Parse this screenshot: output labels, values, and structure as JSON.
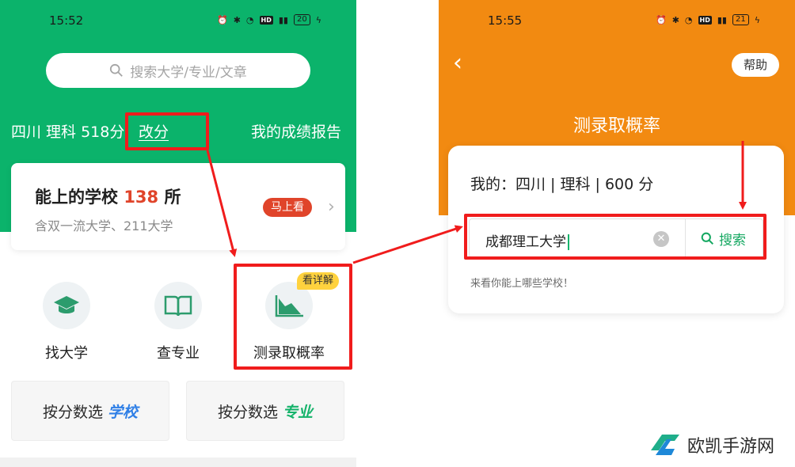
{
  "left_phone": {
    "status": {
      "time": "15:52",
      "battery": "20"
    },
    "search": {
      "placeholder": "搜索大学/专业/文章"
    },
    "score": {
      "province_subject_score": "四川 理科 518分",
      "edit_label": "改分",
      "report_label": "我的成绩报告"
    },
    "schools_card": {
      "title_prefix": "能上的学校",
      "count": "138",
      "title_suffix": "所",
      "subtitle": "含双一流大学、211大学",
      "badge": "马上看"
    },
    "tiles": [
      {
        "label": "找大学",
        "icon": "graduation-cap-icon"
      },
      {
        "label": "查专业",
        "icon": "open-book-icon"
      },
      {
        "label": "测录取概率",
        "icon": "area-chart-icon",
        "tag": "看详解"
      }
    ],
    "bottom_buttons": [
      {
        "prefix": "按分数选",
        "highlight": "学校"
      },
      {
        "prefix": "按分数选",
        "highlight": "专业"
      }
    ]
  },
  "right_phone": {
    "status": {
      "time": "15:55",
      "battery": "21"
    },
    "help_label": "帮助",
    "title": "测录取概率",
    "mine_line": "我的：四川 | 理科 | 600 分",
    "input_value": "成都理工大学",
    "search_button": "搜索",
    "hint": "来看你能上哪些学校！"
  },
  "watermark": {
    "text": "欧凯手游网"
  },
  "colors": {
    "green": "#0bb36b",
    "orange": "#f28a11",
    "red": "#f01c1c",
    "accent_red": "#e0442a"
  }
}
